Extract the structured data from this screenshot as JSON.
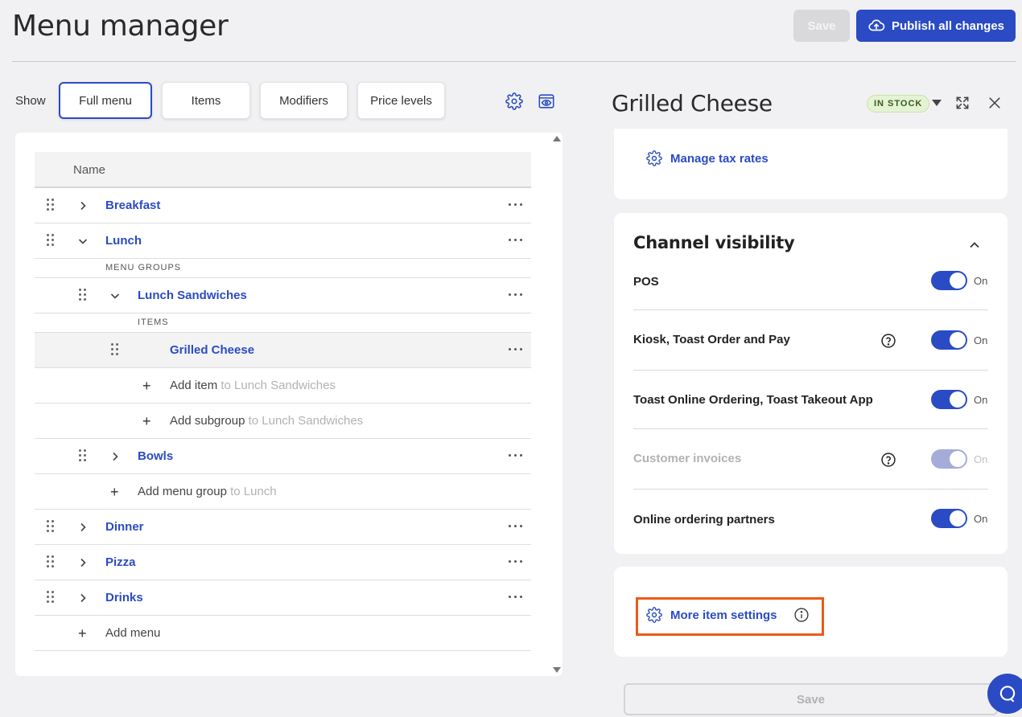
{
  "header": {
    "title": "Menu manager",
    "save_label": "Save",
    "publish_label": "Publish all changes"
  },
  "show_bar": {
    "label": "Show",
    "tabs": [
      {
        "label": "Full menu",
        "active": true
      },
      {
        "label": "Items",
        "active": false
      },
      {
        "label": "Modifiers",
        "active": false
      },
      {
        "label": "Price levels",
        "active": false
      }
    ]
  },
  "tree": {
    "column_header": "Name",
    "menus": {
      "breakfast": "Breakfast",
      "lunch": "Lunch",
      "dinner": "Dinner",
      "pizza": "Pizza",
      "drinks": "Drinks"
    },
    "menu_groups_label": "MENU GROUPS",
    "items_label": "ITEMS",
    "group_lunch_sandwiches": "Lunch Sandwiches",
    "group_bowls": "Bowls",
    "item_grilled_cheese": "Grilled Cheese",
    "add_item": {
      "text": "Add item",
      "hint": "to Lunch Sandwiches"
    },
    "add_subgroup": {
      "text": "Add subgroup",
      "hint": "to Lunch Sandwiches"
    },
    "add_menu_group": {
      "text": "Add menu group",
      "hint": "to Lunch"
    },
    "add_menu": "Add menu"
  },
  "detail": {
    "title": "Grilled Cheese",
    "stock_badge": "IN STOCK",
    "manage_tax_rates": "Manage tax rates",
    "channel_visibility": {
      "title": "Channel visibility",
      "channels": [
        {
          "label": "POS",
          "state": "On",
          "enabled": true,
          "help": false
        },
        {
          "label": "Kiosk, Toast Order and Pay",
          "state": "On",
          "enabled": true,
          "help": true
        },
        {
          "label": "Toast Online Ordering, Toast Takeout App",
          "state": "On",
          "enabled": true,
          "help": false
        },
        {
          "label": "Customer invoices",
          "state": "On",
          "enabled": false,
          "help": true
        },
        {
          "label": "Online ordering partners",
          "state": "On",
          "enabled": true,
          "help": false
        }
      ]
    },
    "more_item_settings": "More item settings",
    "footer_save": "Save"
  },
  "colors": {
    "accent": "#2b4bc4",
    "highlight": "#ec5a17",
    "in_stock_bg": "#e3f3d3"
  }
}
